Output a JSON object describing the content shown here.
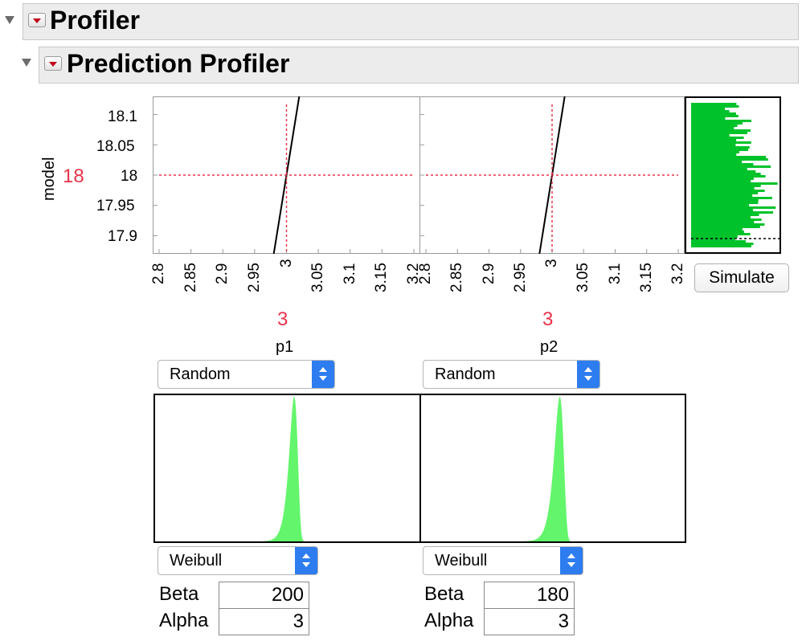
{
  "outline": {
    "profiler_title": "Profiler",
    "prediction_title": "Prediction Profiler"
  },
  "response": {
    "label": "model",
    "current_value": "18",
    "ticks": [
      "18.1",
      "18.05",
      "18",
      "17.95",
      "17.9"
    ]
  },
  "factors": [
    {
      "name": "p1",
      "current_value": "3",
      "ticks": [
        "2.8",
        "2.85",
        "2.9",
        "2.95",
        "3",
        "3.05",
        "3.1",
        "3.15",
        "3.2"
      ],
      "mode": "Random",
      "distribution": "Weibull",
      "params": [
        {
          "label": "Beta",
          "value": "200"
        },
        {
          "label": "Alpha",
          "value": "3"
        }
      ]
    },
    {
      "name": "p2",
      "current_value": "3",
      "ticks": [
        "2.8",
        "2.85",
        "2.9",
        "2.95",
        "3",
        "3.05",
        "3.1",
        "3.15",
        "3.2"
      ],
      "mode": "Random",
      "distribution": "Weibull",
      "params": [
        {
          "label": "Beta",
          "value": "180"
        },
        {
          "label": "Alpha",
          "value": "3"
        }
      ]
    }
  ],
  "simulate_label": "Simulate",
  "colors": {
    "accent_red": "#e8334a",
    "histogram_green": "#00c22a",
    "density_green": "#63f56b",
    "select_blue": "#2e7df0"
  },
  "chart_data": [
    {
      "type": "line",
      "xlabel": "p1",
      "ylabel": "model",
      "xlim": [
        2.8,
        3.2
      ],
      "ylim": [
        17.87,
        18.13
      ],
      "x": [
        2.98,
        3.02
      ],
      "y": [
        17.87,
        18.13
      ],
      "current_x": 3,
      "current_y": 18
    },
    {
      "type": "line",
      "xlabel": "p2",
      "ylabel": "model",
      "xlim": [
        2.8,
        3.2
      ],
      "ylim": [
        17.87,
        18.13
      ],
      "x": [
        2.98,
        3.02
      ],
      "y": [
        17.87,
        18.13
      ],
      "current_x": 3,
      "current_y": 18
    }
  ]
}
